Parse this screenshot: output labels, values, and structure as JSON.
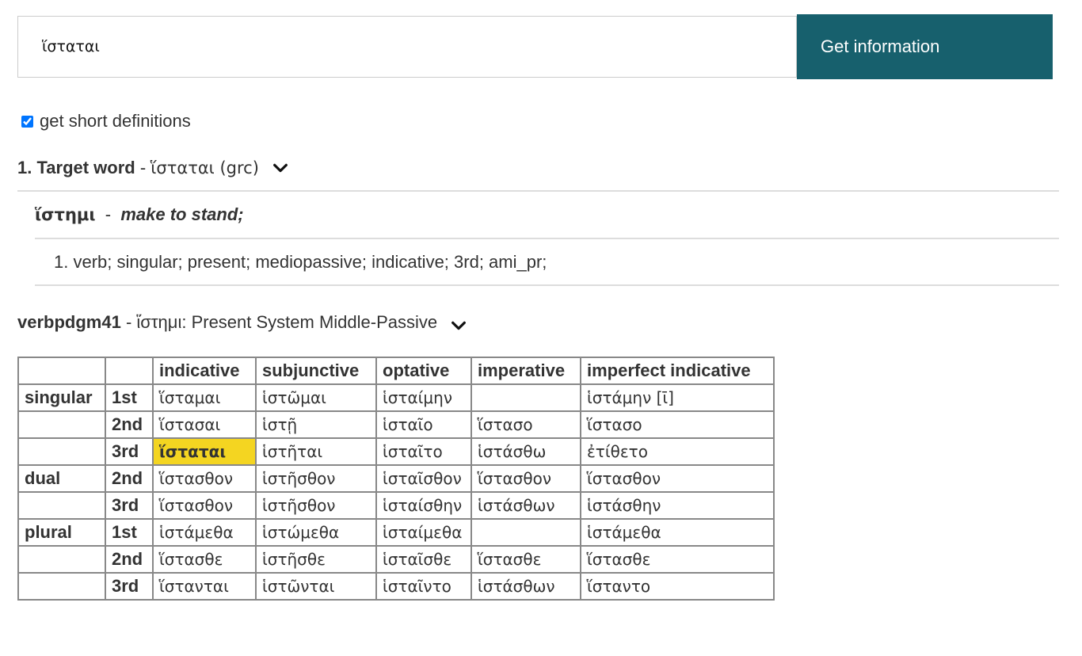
{
  "search": {
    "value": "ἵσταται",
    "button_label": "Get information"
  },
  "options": {
    "short_definitions_label": "get short definitions",
    "short_definitions_checked": true
  },
  "target": {
    "label": "1. Target word",
    "separator": " - ",
    "word": "ἵσταται (grc)"
  },
  "lemma": {
    "word": "ἵστημι",
    "separator": " - ",
    "definition": "make to stand;"
  },
  "analysis": {
    "text": "1. verb; singular; present; mediopassive; indicative; 3rd; ami_pr;"
  },
  "paradigm": {
    "id": "verbpdgm41",
    "separator": " - ",
    "title": "ἵστημι: Present System Middle-Passive",
    "columns": [
      "",
      "",
      "indicative",
      "subjunctive",
      "optative",
      "imperative",
      "imperfect indicative"
    ],
    "rows": [
      {
        "number": "singular",
        "person": "1st",
        "cells": [
          "ἵσταμαι",
          "ἱστῶμαι",
          "ἱσταίμην",
          "",
          "ἱστάμην [ῑ]"
        ]
      },
      {
        "number": "",
        "person": "2nd",
        "cells": [
          "ἵστασαι",
          "ἱστῇ",
          "ἱσταῖο",
          "ἵστασο",
          "ἵστασο"
        ]
      },
      {
        "number": "",
        "person": "3rd",
        "cells": [
          "ἵσταται",
          "ἱστῆται",
          "ἱσταῖτο",
          "ἱστάσθω",
          "ἐτίθετο"
        ]
      },
      {
        "number": "dual",
        "person": "2nd",
        "cells": [
          "ἵστασθον",
          "ἱστῆσθον",
          "ἱσταῖσθον",
          "ἵστασθον",
          "ἵστασθον"
        ]
      },
      {
        "number": "",
        "person": "3rd",
        "cells": [
          "ἵστασθον",
          "ἱστῆσθον",
          "ἱσταίσθην",
          "ἱστάσθων",
          "ἱστάσθην"
        ]
      },
      {
        "number": "plural",
        "person": "1st",
        "cells": [
          "ἱστάμεθα",
          "ἱστώμεθα",
          "ἱσταίμεθα",
          "",
          "ἱστάμεθα"
        ]
      },
      {
        "number": "",
        "person": "2nd",
        "cells": [
          "ἵστασθε",
          "ἱστῆσθε",
          "ἱσταῖσθε",
          "ἵστασθε",
          "ἵστασθε"
        ]
      },
      {
        "number": "",
        "person": "3rd",
        "cells": [
          "ἵστανται",
          "ἱστῶνται",
          "ἱσταῖντο",
          "ἱστάσθων",
          "ἵσταντο"
        ]
      }
    ],
    "highlighted_form": "ἵσταται",
    "highlight_color": "#f4d521"
  },
  "colors": {
    "button_bg": "#17606d",
    "text": "#333333",
    "rule": "#dddddd",
    "table_border": "#888888"
  },
  "icons": {
    "expand": "chevron-down-icon"
  }
}
